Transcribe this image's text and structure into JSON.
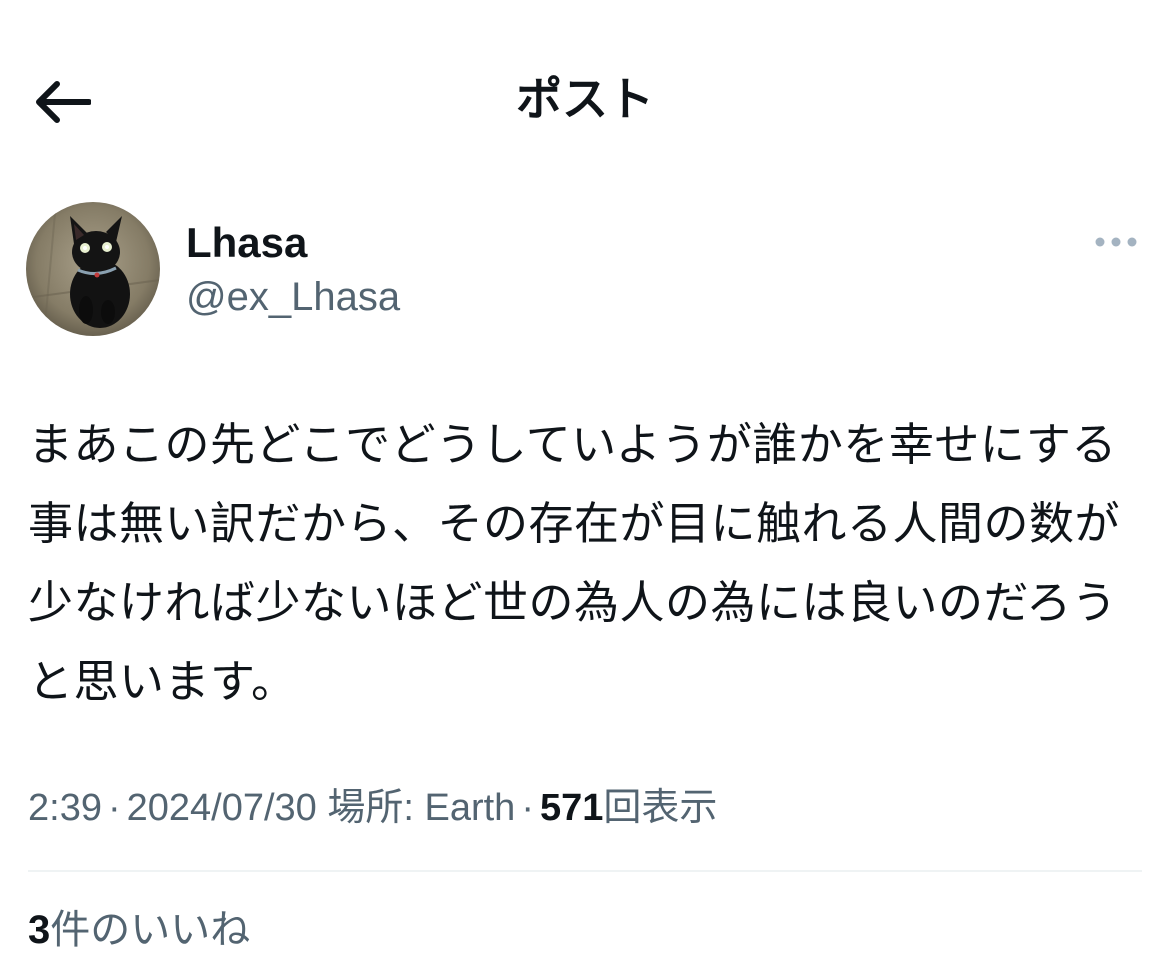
{
  "header": {
    "back_icon": "arrow-left-icon",
    "title": "ポスト"
  },
  "author": {
    "avatar_icon": "black-cat-avatar",
    "display_name": "Lhasa",
    "handle": "@ex_Lhasa",
    "more_icon": "more-horizontal-icon"
  },
  "tweet": {
    "text": "まあこの先どこでどうしていようが誰かを幸せにする事は無い訳だから、その存在が目に触れる人間の数が少なければ少ないほど世の為人の為には良いのだろうと思います。"
  },
  "meta": {
    "time": "2:39",
    "separator": "·",
    "date": "2024/07/30",
    "location": "場所: Earth",
    "views_count": "571",
    "views_label": "回表示"
  },
  "engagement": {
    "likes_count": "3",
    "likes_label": "件のいいね"
  },
  "colors": {
    "text_primary": "#0f1419",
    "text_secondary": "#536471",
    "divider": "#eff3f4",
    "more_dots": "#a4b3c1"
  }
}
